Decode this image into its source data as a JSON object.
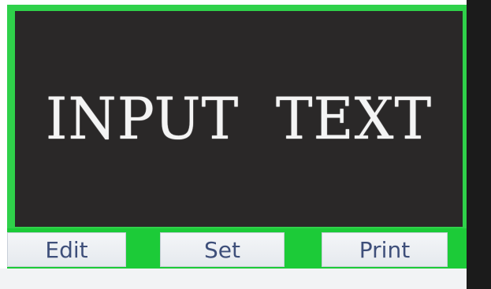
{
  "display": {
    "text": "INPUT  TEXT"
  },
  "toolbar": {
    "edit_label": "Edit",
    "set_label": "Set",
    "print_label": "Print"
  },
  "colors": {
    "frame_green": "#2fd14a",
    "display_background": "#2a2828",
    "display_text": "#f4f4f4",
    "button_text": "#3e4f7a"
  }
}
